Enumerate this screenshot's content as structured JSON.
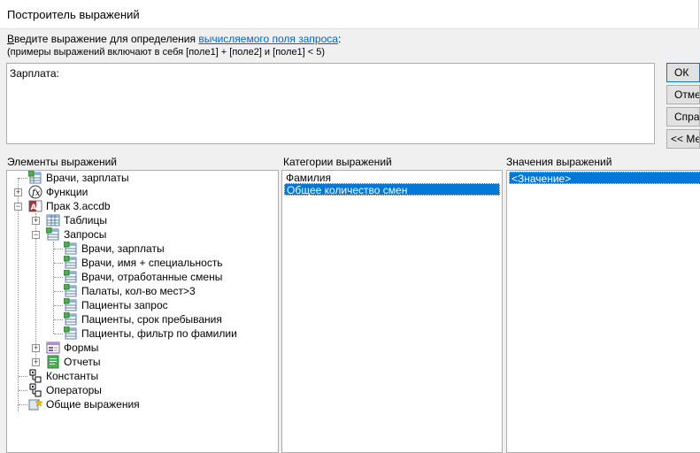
{
  "window": {
    "title": "Построитель выражений"
  },
  "hint": {
    "accel": "В",
    "prefix": "ведите выражение для определения ",
    "link": "вычисляемого поля запроса",
    "suffix": ":",
    "examples": "(примеры выражений включают в себя [поле1] + [поле2] и [поле1] < 5)"
  },
  "expression": {
    "value": "Зарплата:"
  },
  "buttons": {
    "ok": "ОК",
    "cancel": "Отмена",
    "help": "Справка",
    "less": "<< Меньше"
  },
  "labels": {
    "elements": "Элементы выражений",
    "categories": "Категории выражений",
    "values": "Значения выражений"
  },
  "tree": {
    "items": [
      {
        "label": "Врачи, зарплаты"
      },
      {
        "label": "Функции"
      },
      {
        "label": "Прак 3.accdb"
      },
      {
        "label": "Таблицы"
      },
      {
        "label": "Запросы"
      },
      {
        "label": "Врачи, зарплаты"
      },
      {
        "label": "Врачи, имя + специальность"
      },
      {
        "label": "Врачи, отработанные смены"
      },
      {
        "label": "Палаты, кол-во мест>3"
      },
      {
        "label": "Пациенты запрос"
      },
      {
        "label": "Пациенты, срок пребывания"
      },
      {
        "label": "Пациенты, фильтр по фамилии"
      },
      {
        "label": "Формы"
      },
      {
        "label": "Отчеты"
      },
      {
        "label": "Константы"
      },
      {
        "label": "Операторы"
      },
      {
        "label": "Общие выражения"
      }
    ]
  },
  "categories": {
    "items": [
      "Фамилия",
      "Общее количество смен"
    ],
    "selected_index": 1
  },
  "values": {
    "items": [
      "<Значение>"
    ],
    "selected_index": 0
  },
  "colors": {
    "selection": "#0078d7",
    "link": "#0066cc",
    "ok_border": "#0078d7"
  }
}
